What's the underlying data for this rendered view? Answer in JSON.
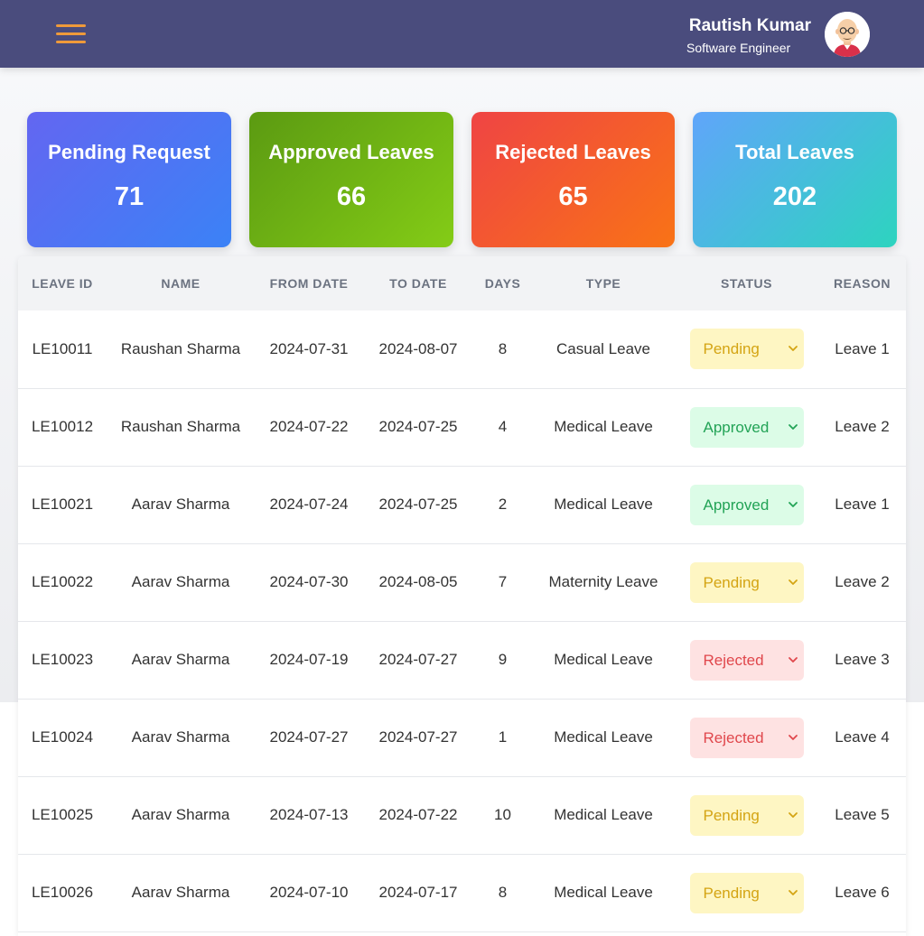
{
  "header": {
    "user_name": "Rautish Kumar",
    "user_role": "Software Engineer",
    "menu_icon": "hamburger-menu-icon",
    "accent_color": "#ef9a3a",
    "bar_color": "#4a4c7d"
  },
  "cards": [
    {
      "label": "Pending Request",
      "value": "71"
    },
    {
      "label": "Approved Leaves",
      "value": "66"
    },
    {
      "label": "Rejected Leaves",
      "value": "65"
    },
    {
      "label": "Total Leaves",
      "value": "202"
    }
  ],
  "table": {
    "headers": [
      "LEAVE ID",
      "NAME",
      "FROM DATE",
      "TO DATE",
      "DAYS",
      "TYPE",
      "STATUS",
      "REASON"
    ],
    "rows": [
      {
        "id": "LE10011",
        "name": "Raushan Sharma",
        "from": "2024-07-31",
        "to": "2024-08-07",
        "days": "8",
        "type": "Casual Leave",
        "status": "Pending",
        "reason": "Leave 1"
      },
      {
        "id": "LE10012",
        "name": "Raushan Sharma",
        "from": "2024-07-22",
        "to": "2024-07-25",
        "days": "4",
        "type": "Medical Leave",
        "status": "Approved",
        "reason": "Leave 2"
      },
      {
        "id": "LE10021",
        "name": "Aarav Sharma",
        "from": "2024-07-24",
        "to": "2024-07-25",
        "days": "2",
        "type": "Medical Leave",
        "status": "Approved",
        "reason": "Leave 1"
      },
      {
        "id": "LE10022",
        "name": "Aarav Sharma",
        "from": "2024-07-30",
        "to": "2024-08-05",
        "days": "7",
        "type": "Maternity Leave",
        "status": "Pending",
        "reason": "Leave 2"
      },
      {
        "id": "LE10023",
        "name": "Aarav Sharma",
        "from": "2024-07-19",
        "to": "2024-07-27",
        "days": "9",
        "type": "Medical Leave",
        "status": "Rejected",
        "reason": "Leave 3"
      },
      {
        "id": "LE10024",
        "name": "Aarav Sharma",
        "from": "2024-07-27",
        "to": "2024-07-27",
        "days": "1",
        "type": "Medical Leave",
        "status": "Rejected",
        "reason": "Leave 4"
      },
      {
        "id": "LE10025",
        "name": "Aarav Sharma",
        "from": "2024-07-13",
        "to": "2024-07-22",
        "days": "10",
        "type": "Medical Leave",
        "status": "Pending",
        "reason": "Leave 5"
      },
      {
        "id": "LE10026",
        "name": "Aarav Sharma",
        "from": "2024-07-10",
        "to": "2024-07-17",
        "days": "8",
        "type": "Medical Leave",
        "status": "Pending",
        "reason": "Leave 6"
      }
    ]
  },
  "status_colors": {
    "Pending": {
      "bg": "#fef6c3",
      "fg": "#d4a413"
    },
    "Approved": {
      "bg": "#dcfce7",
      "fg": "#22a356"
    },
    "Rejected": {
      "bg": "#fee2e2",
      "fg": "#e0474c"
    }
  }
}
